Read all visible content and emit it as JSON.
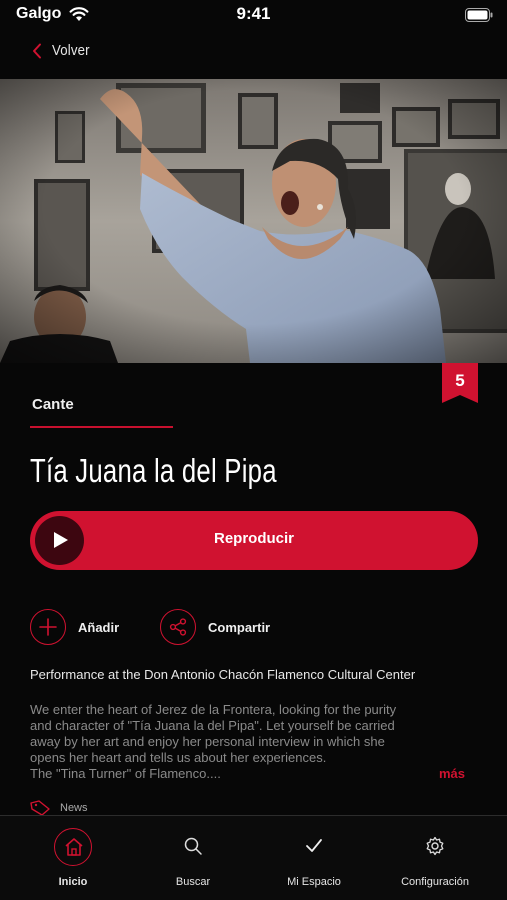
{
  "status_bar": {
    "carrier": "Galgo",
    "time": "9:41"
  },
  "nav": {
    "back_label": "Volver"
  },
  "rank_badge": "5",
  "content": {
    "category": "Cante",
    "title": "Tía Juana la del Pipa",
    "play_label": "Reproducir",
    "add_label": "Añadir",
    "share_label": "Compartir",
    "subtitle": "Performance at the Don Antonio Chacón Flamenco Cultural Center",
    "description_lines": [
      "We enter the heart of Jerez de la Frontera, looking for the purity",
      "and character of \"Tía Juana la del Pipa\". Let yourself be carried",
      "away by her art and enjoy her personal interview in which she",
      "opens her heart and tells us about her experiences.",
      "The \"Tina Turner\" of Flamenco...."
    ],
    "more_label": "más",
    "tag": "News"
  },
  "tabs": [
    {
      "label": "Inicio",
      "icon": "home-icon",
      "active": true
    },
    {
      "label": "Buscar",
      "icon": "search-icon",
      "active": false
    },
    {
      "label": "Mi Espacio",
      "icon": "checkmark-icon",
      "active": false
    },
    {
      "label": "Configuración",
      "icon": "gear-icon",
      "active": false
    }
  ],
  "colors": {
    "accent": "#d01230",
    "background": "#070707",
    "play_circle": "#3d0610"
  }
}
